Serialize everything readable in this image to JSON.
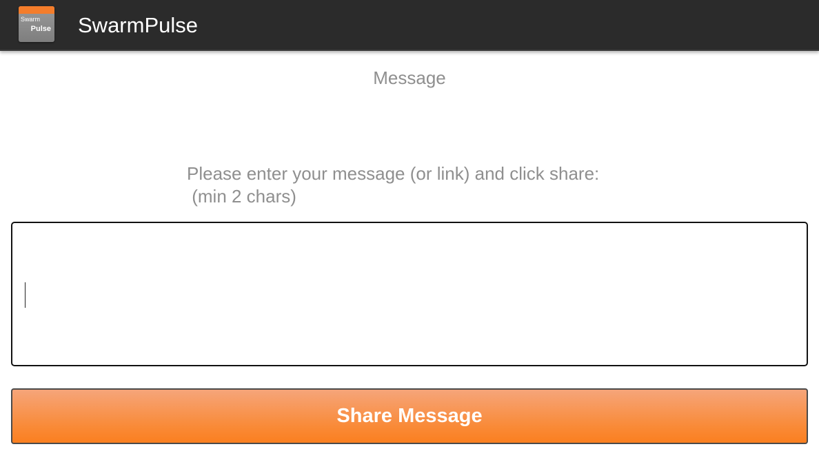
{
  "app_bar": {
    "title": "SwarmPulse",
    "icon": {
      "name": "swarmpulse-logo-icon",
      "line1": "Swarm",
      "line2": "Pulse",
      "accent_color": "#f47d2b"
    }
  },
  "main": {
    "section_title": "Message",
    "instructions": "Please enter your message (or link) and click share:\n (min 2 chars)",
    "message_input": {
      "value": "",
      "placeholder": ""
    },
    "share_button_label": "Share Message",
    "share_button_color": "#f98a37"
  }
}
